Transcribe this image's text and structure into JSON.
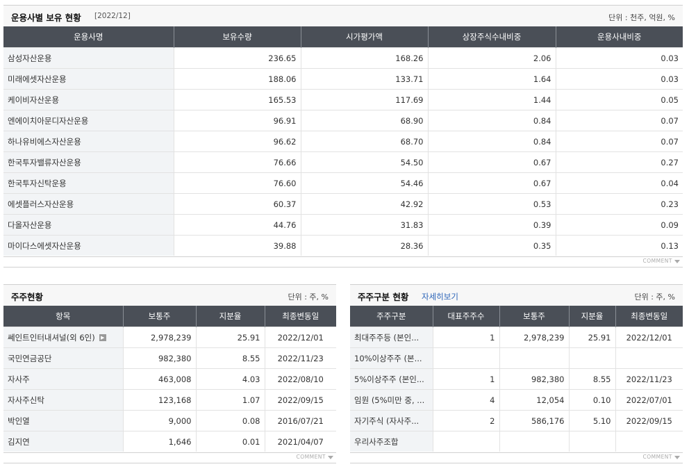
{
  "fund_holdings": {
    "title": "운용사별 보유 현황",
    "period": "[2022/12]",
    "unit": "단위 : 천주, 억원, %",
    "columns": [
      "운용사명",
      "보유수량",
      "시가평가액",
      "상장주식수내비중",
      "운용사내비중"
    ],
    "rows": [
      [
        "삼성자산운용",
        "236.65",
        "168.26",
        "2.06",
        "0.03"
      ],
      [
        "미래에셋자산운용",
        "188.06",
        "133.71",
        "1.64",
        "0.03"
      ],
      [
        "케이비자산운용",
        "165.53",
        "117.69",
        "1.44",
        "0.05"
      ],
      [
        "엔에이치아문디자산운용",
        "96.91",
        "68.90",
        "0.84",
        "0.07"
      ],
      [
        "하나유비에스자산운용",
        "96.62",
        "68.70",
        "0.84",
        "0.07"
      ],
      [
        "한국투자밸류자산운용",
        "76.66",
        "54.50",
        "0.67",
        "0.27"
      ],
      [
        "한국투자신탁운용",
        "76.60",
        "54.46",
        "0.67",
        "0.04"
      ],
      [
        "에셋플러스자산운용",
        "60.37",
        "42.92",
        "0.53",
        "0.23"
      ],
      [
        "다올자산운용",
        "44.76",
        "31.83",
        "0.39",
        "0.09"
      ],
      [
        "마이다스에셋자산운용",
        "39.88",
        "28.36",
        "0.35",
        "0.13"
      ]
    ],
    "comment_label": "COMMENT"
  },
  "shareholders": {
    "title": "주주현황",
    "unit": "단위 : 주, %",
    "columns": [
      "항목",
      "보통주",
      "지분율",
      "최종변동일"
    ],
    "rows": [
      [
        "쎄인트인터내셔널(외 6인)",
        "2,978,239",
        "25.91",
        "2022/12/01"
      ],
      [
        "국민연금공단",
        "982,380",
        "8.55",
        "2022/11/23"
      ],
      [
        "자사주",
        "463,008",
        "4.03",
        "2022/08/10"
      ],
      [
        "자사주신탁",
        "123,168",
        "1.07",
        "2022/09/15"
      ],
      [
        "박인열",
        "9,000",
        "0.08",
        "2016/07/21"
      ],
      [
        "김지연",
        "1,646",
        "0.01",
        "2021/04/07"
      ]
    ],
    "comment_label": "COMMENT"
  },
  "shareholder_types": {
    "title": "주주구분 현황",
    "detail_link": "자세히보기",
    "unit": "단위 : 주, %",
    "columns": [
      "주주구분",
      "대표주주수",
      "보통주",
      "지분율",
      "최종변동일"
    ],
    "rows": [
      [
        "최대주주등 (본인...",
        "1",
        "2,978,239",
        "25.91",
        "2022/12/01"
      ],
      [
        "10%이상주주 (본...",
        "",
        "",
        "",
        ""
      ],
      [
        "5%이상주주 (본인...",
        "1",
        "982,380",
        "8.55",
        "2022/11/23"
      ],
      [
        "임원 (5%미만 중, ...",
        "4",
        "12,054",
        "0.10",
        "2022/07/01"
      ],
      [
        "자기주식 (자사주...",
        "2",
        "586,176",
        "5.10",
        "2022/09/15"
      ],
      [
        "우리사주조합",
        "",
        "",
        "",
        ""
      ]
    ],
    "comment_label": "COMMENT"
  }
}
